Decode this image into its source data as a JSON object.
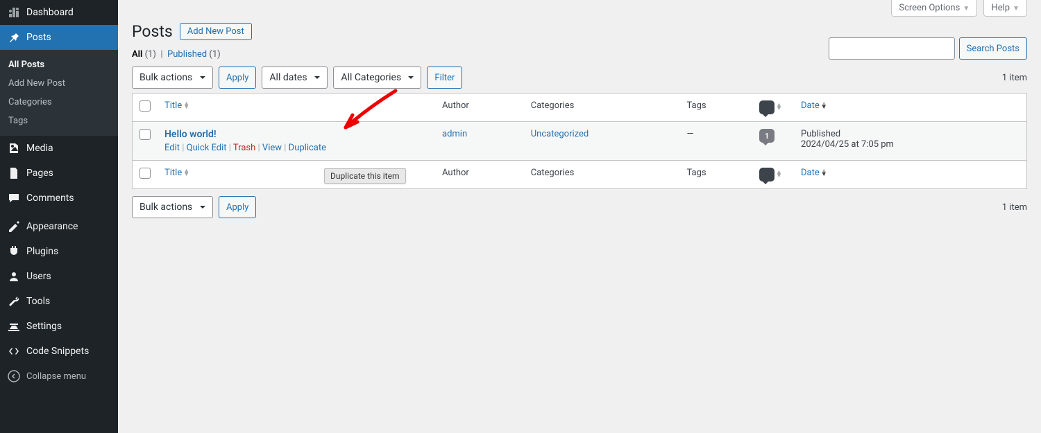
{
  "sidebar": {
    "dashboard": "Dashboard",
    "posts": "Posts",
    "posts_sub": {
      "all": "All Posts",
      "add": "Add New Post",
      "categories": "Categories",
      "tags": "Tags"
    },
    "media": "Media",
    "pages": "Pages",
    "comments": "Comments",
    "appearance": "Appearance",
    "plugins": "Plugins",
    "users": "Users",
    "tools": "Tools",
    "settings": "Settings",
    "code_snippets": "Code Snippets",
    "collapse": "Collapse menu"
  },
  "top_tabs": {
    "screen_options": "Screen Options",
    "help": "Help"
  },
  "page": {
    "heading": "Posts",
    "add_new": "Add New Post"
  },
  "subsubsub": {
    "all_label": "All",
    "all_count": "(1)",
    "published_label": "Published",
    "published_count": "(1)"
  },
  "search": {
    "button": "Search Posts"
  },
  "filters": {
    "bulk": "Bulk actions",
    "apply": "Apply",
    "dates": "All dates",
    "categories": "All Categories",
    "filter": "Filter"
  },
  "count": {
    "label": "1 item"
  },
  "columns": {
    "title": "Title",
    "author": "Author",
    "categories": "Categories",
    "tags": "Tags",
    "date": "Date"
  },
  "row": {
    "title": "Hello world!",
    "author": "admin",
    "category": "Uncategorized",
    "tags": "—",
    "comments": "1",
    "date_status": "Published",
    "date": "2024/04/25 at 7:05 pm",
    "actions": {
      "edit": "Edit",
      "quick_edit": "Quick Edit",
      "trash": "Trash",
      "view": "View",
      "duplicate": "Duplicate"
    }
  },
  "tooltip": "Duplicate this item"
}
